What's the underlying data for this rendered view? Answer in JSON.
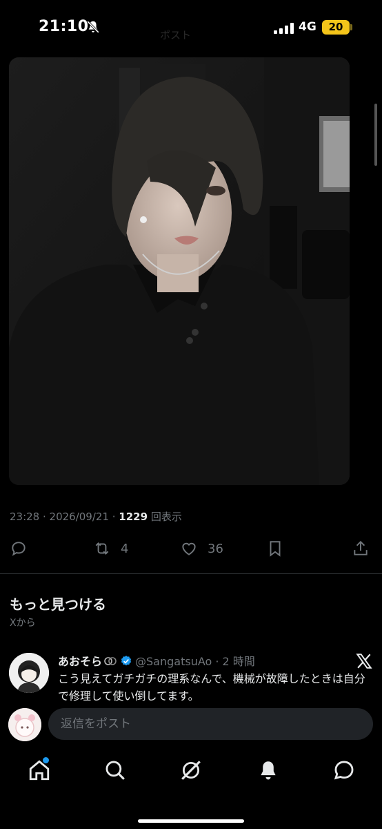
{
  "status_bar": {
    "time": "21:10",
    "faded_title": "ポスト",
    "network": "4G",
    "battery": "20"
  },
  "post": {
    "timestamp": "23:28 · 2026/09/21 · ",
    "views_count": "1229",
    "views_label": " 回表示",
    "retweets": "4",
    "likes": "36"
  },
  "discover": {
    "title": "もっと見つける",
    "subtitle": "Xから"
  },
  "suggested": {
    "name": "あおそら",
    "handle": "@SangatsuAo",
    "time": " · 2 時間",
    "text": "こう見えてガチガチの理系なんで、機械が故障したときは自分で修理して使い倒してます。",
    "verified_color": "#1d9bf0"
  },
  "reply": {
    "placeholder": "返信をポスト"
  },
  "nav": {
    "items": [
      "home-icon",
      "search-icon",
      "grok-icon",
      "notifications-icon",
      "messages-icon"
    ],
    "home_badge_color": "#1d9bf0"
  }
}
